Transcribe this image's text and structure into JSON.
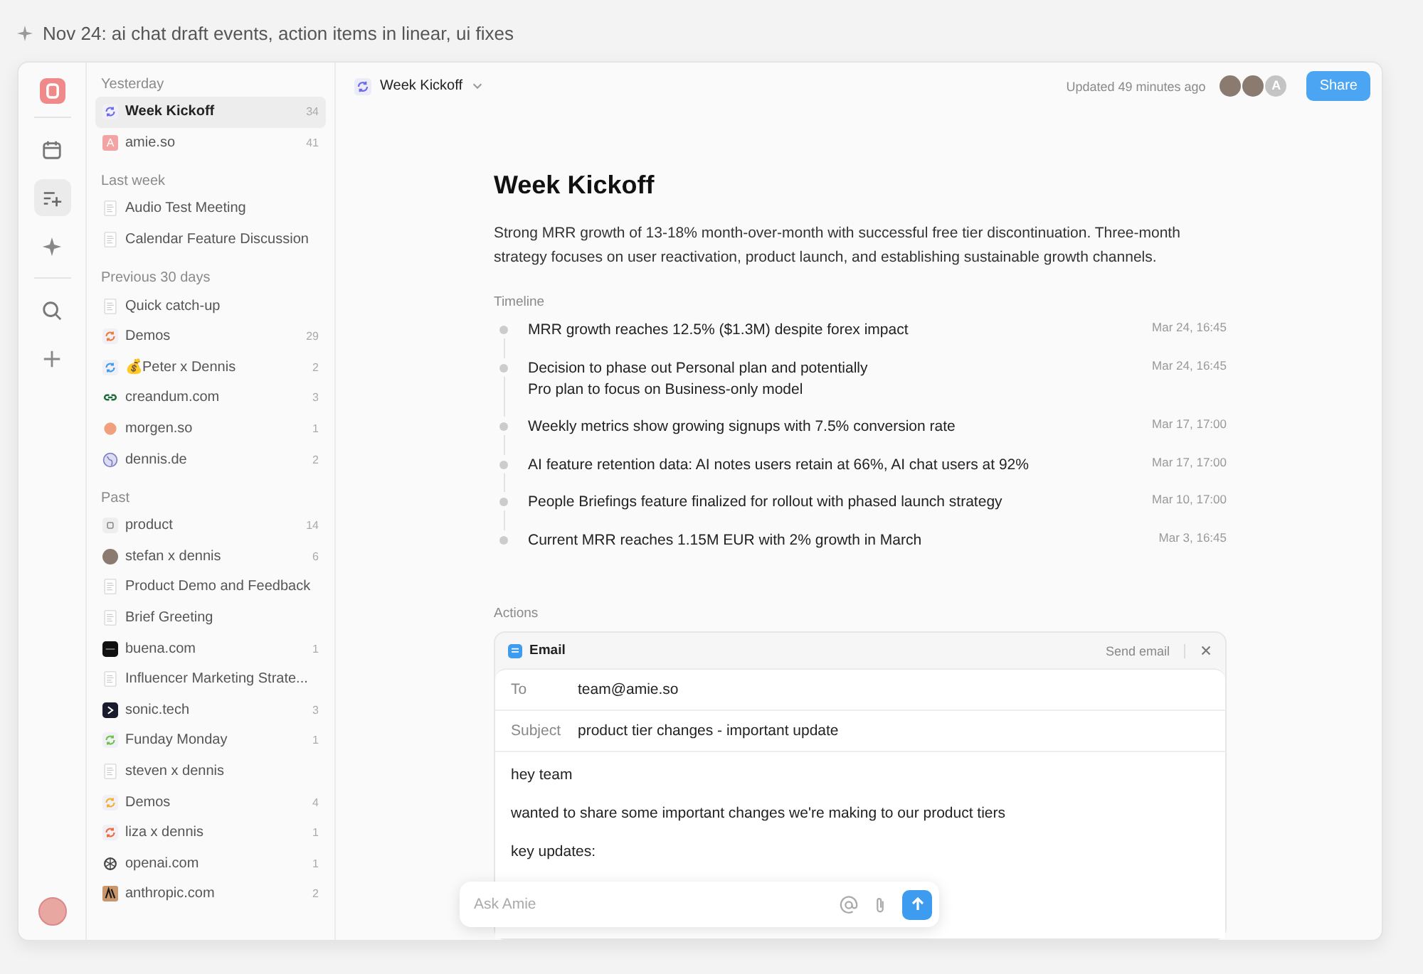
{
  "banner": {
    "title": "Nov 24: ai chat draft events, action items in linear, ui fixes"
  },
  "rail": {
    "items": [
      {
        "kind": "calendar",
        "selected": false
      },
      {
        "kind": "notes",
        "selected": true
      },
      {
        "kind": "sparkle",
        "selected": false
      },
      {
        "kind": "search",
        "selected": false
      },
      {
        "kind": "plus",
        "selected": false
      }
    ]
  },
  "sidebar": {
    "sections": [
      {
        "title": "Yesterday",
        "items": [
          {
            "label": "Week Kickoff",
            "count": "34",
            "kind": "sync",
            "color": "#6b6bf0",
            "selected": true
          },
          {
            "label": "amie.so",
            "count": "41",
            "kind": "letter",
            "letter": "A",
            "color": "#f2a3a3",
            "selected": false
          }
        ]
      },
      {
        "title": "Last week",
        "items": [
          {
            "label": "Audio Test Meeting",
            "kind": "doc",
            "selected": false
          },
          {
            "label": "Calendar Feature Discussion",
            "kind": "doc",
            "selected": false
          }
        ]
      },
      {
        "title": "Previous 30 days",
        "items": [
          {
            "label": "Quick catch-up",
            "kind": "doc",
            "selected": false
          },
          {
            "label": "Demos",
            "count": "29",
            "kind": "sync",
            "color": "#ef7a3a",
            "selected": false
          },
          {
            "label": "💰Peter x Dennis",
            "count": "2",
            "kind": "sync",
            "color": "#3d9bf0",
            "selected": false
          },
          {
            "label": "creandum.com",
            "count": "3",
            "kind": "link",
            "selected": false
          },
          {
            "label": "morgen.so",
            "count": "1",
            "kind": "dot",
            "color": "#f0a07a",
            "selected": false
          },
          {
            "label": "dennis.de",
            "count": "2",
            "kind": "globe",
            "selected": false
          }
        ]
      },
      {
        "title": "Past",
        "items": [
          {
            "label": "product",
            "count": "14",
            "kind": "square",
            "selected": false
          },
          {
            "label": "stefan x dennis",
            "count": "6",
            "kind": "photo",
            "selected": false
          },
          {
            "label": "Product Demo and Feedback",
            "kind": "doc",
            "selected": false
          },
          {
            "label": "Brief Greeting",
            "kind": "doc",
            "selected": false
          },
          {
            "label": "buena.com",
            "count": "1",
            "kind": "dark",
            "selected": false
          },
          {
            "label": "Influencer Marketing Strate...",
            "kind": "doc",
            "selected": false
          },
          {
            "label": "sonic.tech",
            "count": "3",
            "kind": "chevron",
            "selected": false
          },
          {
            "label": "Funday Monday",
            "count": "1",
            "kind": "sync",
            "color": "#6cc24a",
            "selected": false
          },
          {
            "label": "steven x dennis",
            "kind": "doc",
            "selected": false
          },
          {
            "label": "Demos",
            "count": "4",
            "kind": "sync",
            "color": "#f0b030",
            "selected": false
          },
          {
            "label": "liza x dennis",
            "count": "1",
            "kind": "sync",
            "color": "#ef6a3a",
            "selected": false
          },
          {
            "label": "openai.com",
            "count": "1",
            "kind": "knot",
            "selected": false
          },
          {
            "label": "anthropic.com",
            "count": "2",
            "kind": "tan",
            "selected": false
          }
        ]
      }
    ]
  },
  "header": {
    "title": "Week Kickoff",
    "updated": "Updated 49 minutes ago",
    "avatars": [
      {
        "kind": "photo"
      },
      {
        "kind": "photo"
      },
      {
        "kind": "letter",
        "letter": "A"
      }
    ],
    "share": "Share"
  },
  "document": {
    "title": "Week Kickoff",
    "summary": "Strong MRR growth of 13-18% month-over-month with successful free tier discontinuation. Three-month strategy focuses on user reactivation, product launch, and establishing sustainable growth channels.",
    "timeline_label": "Timeline",
    "timeline": [
      {
        "text": "MRR growth reaches 12.5% ($1.3M) despite forex impact",
        "time": "Mar 24, 16:45"
      },
      {
        "text": "Decision to phase out Personal plan and potentially\nPro plan to focus on Business-only model",
        "time": "Mar 24, 16:45"
      },
      {
        "text": "Weekly metrics show growing signups with 7.5% conversion rate",
        "time": "Mar 17, 17:00"
      },
      {
        "text": "AI feature retention data: AI notes users retain at 66%, AI chat users at 92%",
        "time": "Mar 17, 17:00"
      },
      {
        "text": "People Briefings feature finalized for rollout with phased launch strategy",
        "time": "Mar 10, 17:00"
      },
      {
        "text": "Current MRR reaches 1.15M EUR with 2% growth in March",
        "time": "Mar 3, 16:45"
      }
    ],
    "actions_label": "Actions",
    "email": {
      "title": "Email",
      "send": "Send email",
      "fields": [
        {
          "label": "To",
          "value": "team@amie.so"
        },
        {
          "label": "Subject",
          "value": "product tier changes - important update"
        }
      ],
      "body": [
        "hey team",
        "wanted to share some important changes we're making to our product tiers",
        "key updates:"
      ]
    }
  },
  "ask": {
    "placeholder": "Ask Amie"
  }
}
